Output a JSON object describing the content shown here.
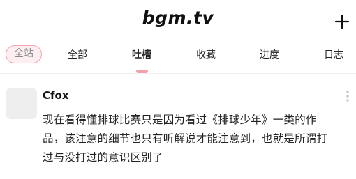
{
  "header": {
    "logo": "bgm.tv",
    "add_icon": "plus-icon"
  },
  "tabs": [
    {
      "label": "全站"
    },
    {
      "label": "全部"
    },
    {
      "label": "吐槽"
    },
    {
      "label": "收藏"
    },
    {
      "label": "进度"
    },
    {
      "label": "日志"
    }
  ],
  "active_tab": "吐槽",
  "colors": {
    "accent": "#f4a1ab",
    "chip_bg": "#fdeff1",
    "divider": "#f1f1f1"
  },
  "post": {
    "username": "Cfox",
    "content_lines": [
      "现在看得懂排球比赛只是因为看过《排球少年》一类的作",
      "品，该注意的细节也只有听解说才能注意到，也就是所谓打",
      "过与没打过的意识区别了"
    ],
    "more_icon": "more-vertical-icon"
  }
}
